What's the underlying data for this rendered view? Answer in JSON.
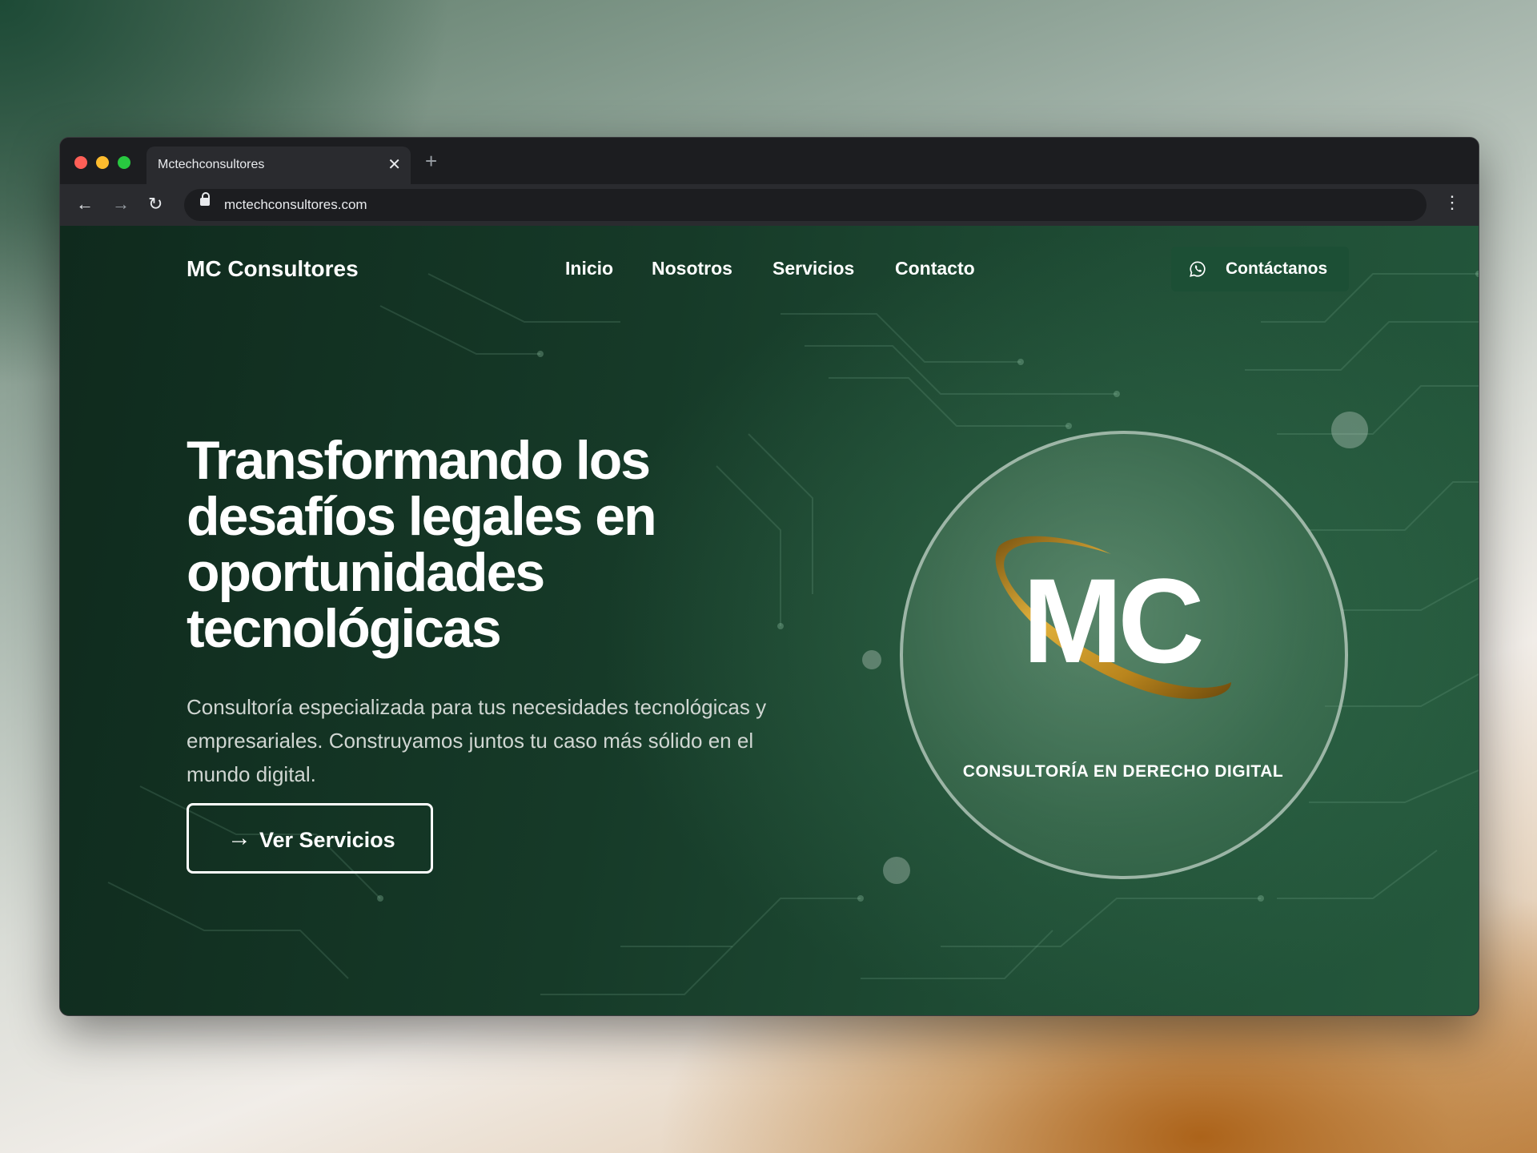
{
  "browser": {
    "tab_title": "Mctechconsultores",
    "url": "mctechconsultores.com"
  },
  "site": {
    "brand": "MC Consultores",
    "nav": [
      "Inicio",
      "Nosotros",
      "Servicios",
      "Contacto"
    ],
    "contact_button": "Contáctanos",
    "headline": "Transformando los desafíos legales en oportunidades tecnológicas",
    "subheadline": "Consultoría especializada para tus necesidades tecnológicas y empresariales. Construyamos juntos tu caso más sólido en el mundo digital.",
    "cta": "Ver Servicios",
    "badge": {
      "logo_letters": "MC",
      "caption": "CONSULTORÍA EN DERECHO DIGITAL"
    }
  },
  "icons": [
    "close-icon",
    "plus-icon",
    "back-arrow-icon",
    "forward-arrow-icon",
    "reload-icon",
    "lock-icon",
    "kebab-menu-icon",
    "whatsapp-icon",
    "arrow-right-icon"
  ],
  "colors": {
    "accent_green": "#1c4f35",
    "background_green": "#163a28",
    "logo_gold": "#c9961f"
  }
}
